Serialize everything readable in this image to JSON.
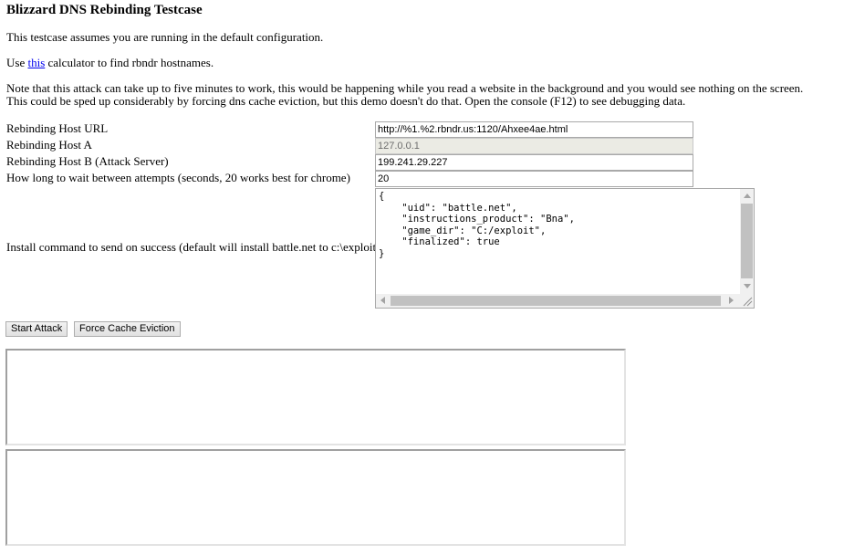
{
  "page": {
    "title": "Blizzard DNS Rebinding Testcase",
    "intro": "This testcase assumes you are running in the default configuration.",
    "calc_prefix": "Use ",
    "calc_link": "this",
    "calc_suffix": " calculator to find rbndr hostnames.",
    "note_line1": "Note that this attack can take up to five minutes to work, this would be happening while you read a website in the background and you would see nothing on the screen.",
    "note_line2": "This could be sped up considerably by forcing dns cache eviction, but this demo doesn't do that. Open the console (F12) to see debugging data."
  },
  "form": {
    "url_label": "Rebinding Host URL",
    "url_value": "http://%1.%2.rbndr.us:1120/Ahxee4ae.html",
    "host_a_label": "Rebinding Host A",
    "host_a_value": "127.0.0.1",
    "host_b_label": "Rebinding Host B (Attack Server)",
    "host_b_value": "199.241.29.227",
    "wait_label": "How long to wait between attempts (seconds, 20 works best for chrome)",
    "wait_value": "20",
    "install_label": "Install command to send on success (default will install battle.net to c:\\exploit)",
    "install_value": "{\n    \"uid\": \"battle.net\",\n    \"instructions_product\": \"Bna\",\n    \"game_dir\": \"C:/exploit\",\n    \"finalized\": true\n}"
  },
  "buttons": {
    "start": "Start Attack",
    "evict": "Force Cache Eviction"
  }
}
